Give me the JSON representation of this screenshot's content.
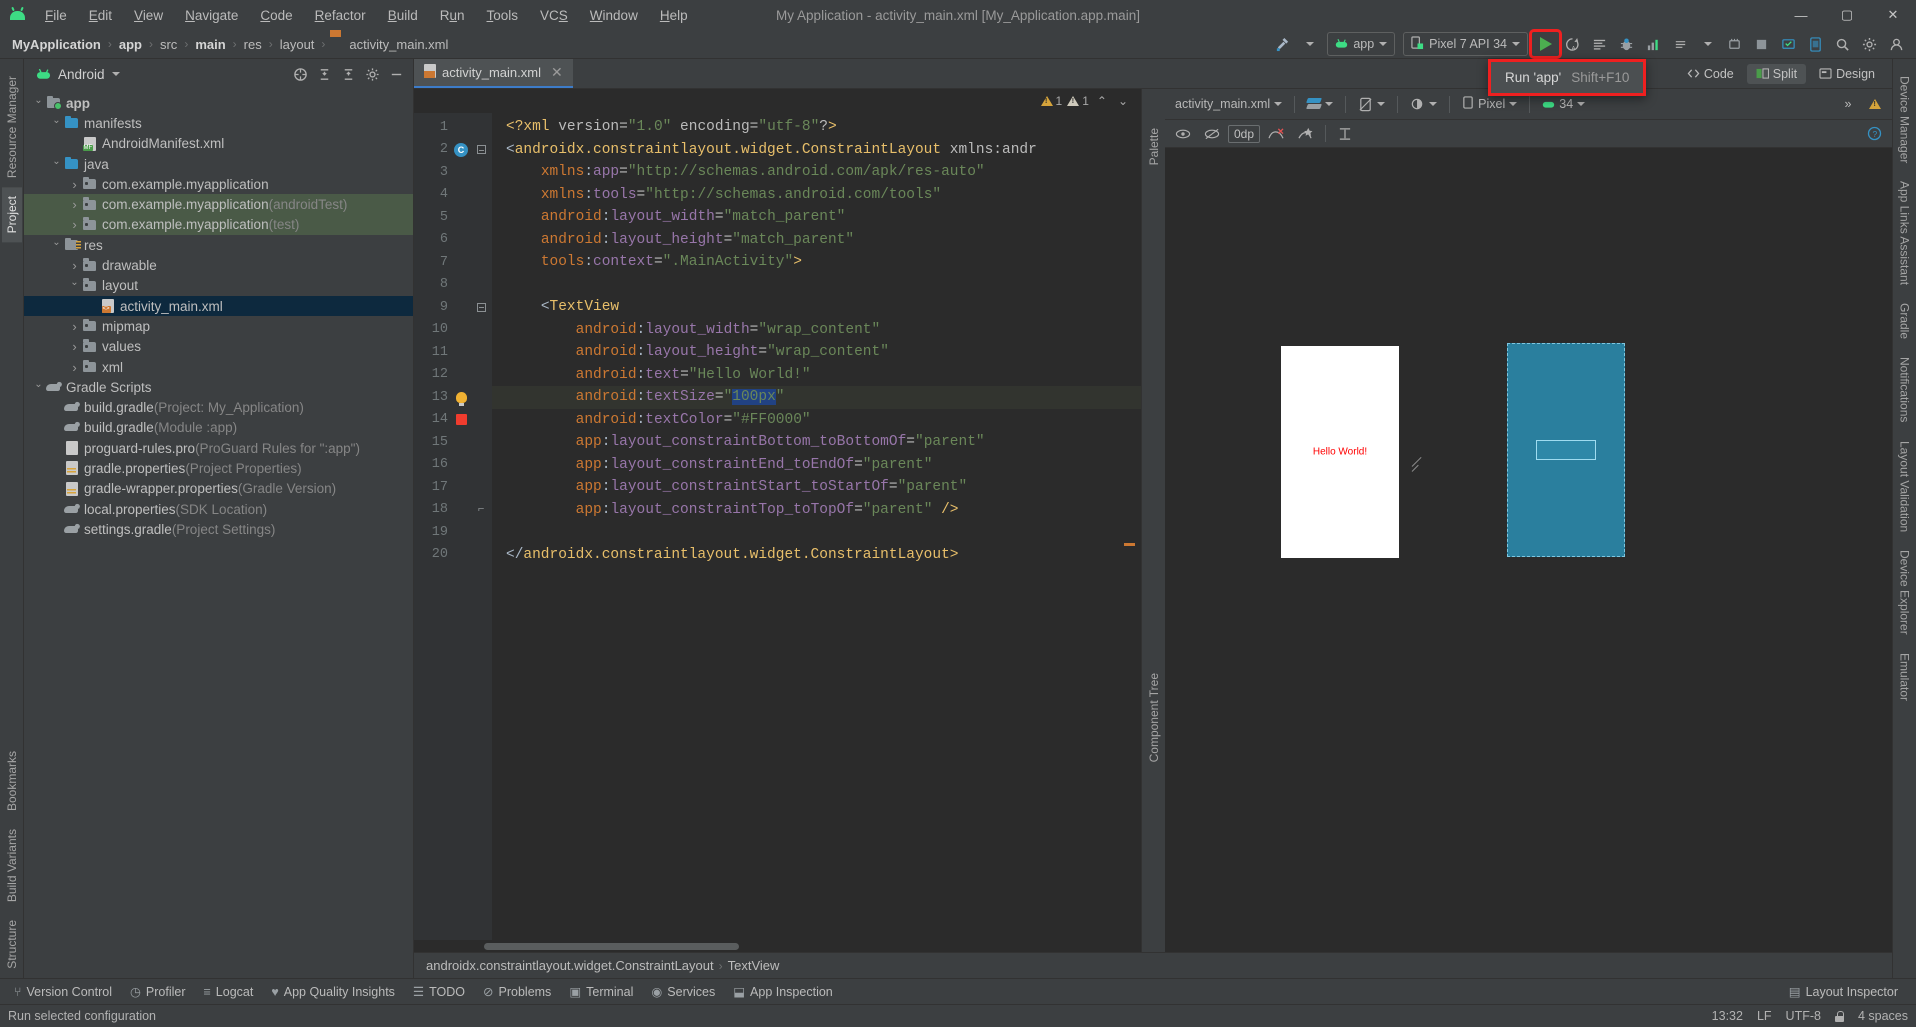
{
  "window": {
    "title": "My Application - activity_main.xml [My_Application.app.main]",
    "minimize": "—",
    "maximize": "▢",
    "close": "✕"
  },
  "menubar": {
    "items": [
      {
        "label": "File"
      },
      {
        "label": "Edit"
      },
      {
        "label": "View"
      },
      {
        "label": "Navigate"
      },
      {
        "label": "Code"
      },
      {
        "label": "Refactor"
      },
      {
        "label": "Build"
      },
      {
        "label": "Run"
      },
      {
        "label": "Tools"
      },
      {
        "label": "VCS"
      },
      {
        "label": "Window"
      },
      {
        "label": "Help"
      }
    ]
  },
  "breadcrumb": {
    "items": [
      "MyApplication",
      "app",
      "src",
      "main",
      "res",
      "layout",
      "activity_main.xml"
    ],
    "separator": "›"
  },
  "toolbar": {
    "build_variant_label": "",
    "module_selector": "app",
    "device_selector": "Pixel 7 API 34",
    "run_tooltip": "Run 'app'",
    "run_tooltip_shortcut": "Shift+F10"
  },
  "project_panel": {
    "title": "Android",
    "tree": [
      {
        "depth": 0,
        "arrow": "open",
        "icon": "folder-module",
        "label": "app",
        "suffix": "",
        "bold": true,
        "state": "none"
      },
      {
        "depth": 1,
        "arrow": "open",
        "icon": "folder-blue",
        "label": "manifests",
        "suffix": "",
        "bold": false,
        "state": "none"
      },
      {
        "depth": 2,
        "arrow": "none",
        "icon": "file-manifest",
        "label": "AndroidManifest.xml",
        "suffix": "",
        "bold": false,
        "state": "none"
      },
      {
        "depth": 1,
        "arrow": "open",
        "icon": "folder-blue",
        "label": "java",
        "suffix": "",
        "bold": false,
        "state": "none"
      },
      {
        "depth": 2,
        "arrow": "closed",
        "icon": "folder-pkg",
        "label": "com.example.myapplication",
        "suffix": "",
        "bold": false,
        "state": "none"
      },
      {
        "depth": 2,
        "arrow": "closed",
        "icon": "folder-pkg",
        "label": "com.example.myapplication",
        "suffix": "(androidTest)",
        "bold": false,
        "state": "green"
      },
      {
        "depth": 2,
        "arrow": "closed",
        "icon": "folder-pkg",
        "label": "com.example.myapplication",
        "suffix": "(test)",
        "bold": false,
        "state": "green"
      },
      {
        "depth": 1,
        "arrow": "open",
        "icon": "folder-res",
        "label": "res",
        "suffix": "",
        "bold": false,
        "state": "none"
      },
      {
        "depth": 2,
        "arrow": "closed",
        "icon": "folder-pkg",
        "label": "drawable",
        "suffix": "",
        "bold": false,
        "state": "none"
      },
      {
        "depth": 2,
        "arrow": "open",
        "icon": "folder-pkg",
        "label": "layout",
        "suffix": "",
        "bold": false,
        "state": "none"
      },
      {
        "depth": 3,
        "arrow": "none",
        "icon": "file-xml",
        "label": "activity_main.xml",
        "suffix": "",
        "bold": false,
        "state": "selected"
      },
      {
        "depth": 2,
        "arrow": "closed",
        "icon": "folder-pkg",
        "label": "mipmap",
        "suffix": "",
        "bold": false,
        "state": "none"
      },
      {
        "depth": 2,
        "arrow": "closed",
        "icon": "folder-pkg",
        "label": "values",
        "suffix": "",
        "bold": false,
        "state": "none"
      },
      {
        "depth": 2,
        "arrow": "closed",
        "icon": "folder-pkg",
        "label": "xml",
        "suffix": "",
        "bold": false,
        "state": "none"
      },
      {
        "depth": 0,
        "arrow": "open",
        "icon": "gradle",
        "label": "Gradle Scripts",
        "suffix": "",
        "bold": false,
        "state": "none"
      },
      {
        "depth": 1,
        "arrow": "none",
        "icon": "gradle",
        "label": "build.gradle",
        "suffix": "(Project: My_Application)",
        "bold": false,
        "state": "none"
      },
      {
        "depth": 1,
        "arrow": "none",
        "icon": "gradle",
        "label": "build.gradle",
        "suffix": "(Module :app)",
        "bold": false,
        "state": "none"
      },
      {
        "depth": 1,
        "arrow": "none",
        "icon": "file-plain",
        "label": "proguard-rules.pro",
        "suffix": "(ProGuard Rules for \":app\")",
        "bold": false,
        "state": "none"
      },
      {
        "depth": 1,
        "arrow": "none",
        "icon": "file-props",
        "label": "gradle.properties",
        "suffix": "(Project Properties)",
        "bold": false,
        "state": "none"
      },
      {
        "depth": 1,
        "arrow": "none",
        "icon": "file-props",
        "label": "gradle-wrapper.properties",
        "suffix": "(Gradle Version)",
        "bold": false,
        "state": "none"
      },
      {
        "depth": 1,
        "arrow": "none",
        "icon": "gradle",
        "label": "local.properties",
        "suffix": "(SDK Location)",
        "bold": false,
        "state": "none"
      },
      {
        "depth": 1,
        "arrow": "none",
        "icon": "gradle",
        "label": "settings.gradle",
        "suffix": "(Project Settings)",
        "bold": false,
        "state": "none"
      }
    ]
  },
  "left_rail": {
    "tabs": [
      "Project",
      "Resource Manager"
    ],
    "bottom_tabs": [
      "Structure",
      "Build Variants",
      "Bookmarks"
    ]
  },
  "right_rail": {
    "tabs": [
      "Device Manager",
      "App Links Assistant",
      "Gradle",
      "Notifications",
      "Layout Validation",
      "Device Explorer",
      "Emulator"
    ]
  },
  "editor": {
    "tab_label": "activity_main.xml",
    "tab_close": "✕",
    "view_modes": [
      {
        "label": "Code",
        "active": false
      },
      {
        "label": "Split",
        "active": true
      },
      {
        "label": "Design",
        "active": false
      }
    ],
    "warnings": {
      "error_count": "1",
      "warning_count": "1"
    },
    "bottom_breadcrumb": [
      "androidx.constraintlayout.widget.ConstraintLayout",
      "TextView"
    ],
    "code_lines": [
      {
        "n": 1,
        "marker": "none",
        "fold": "none",
        "highlight": false,
        "text": "<?xml version=\"1.0\" encoding=\"utf-8\"?>"
      },
      {
        "n": 2,
        "marker": "class",
        "fold": "minus",
        "highlight": false,
        "text": "<androidx.constraintlayout.widget.ConstraintLayout xmlns:andr"
      },
      {
        "n": 3,
        "marker": "none",
        "fold": "none",
        "highlight": false,
        "text": "    xmlns:app=\"http://schemas.android.com/apk/res-auto\""
      },
      {
        "n": 4,
        "marker": "none",
        "fold": "none",
        "highlight": false,
        "text": "    xmlns:tools=\"http://schemas.android.com/tools\""
      },
      {
        "n": 5,
        "marker": "none",
        "fold": "none",
        "highlight": false,
        "text": "    android:layout_width=\"match_parent\""
      },
      {
        "n": 6,
        "marker": "none",
        "fold": "none",
        "highlight": false,
        "text": "    android:layout_height=\"match_parent\""
      },
      {
        "n": 7,
        "marker": "none",
        "fold": "none",
        "highlight": false,
        "text": "    tools:context=\".MainActivity\">"
      },
      {
        "n": 8,
        "marker": "none",
        "fold": "none",
        "highlight": false,
        "text": ""
      },
      {
        "n": 9,
        "marker": "none",
        "fold": "minus",
        "highlight": false,
        "text": "    <TextView"
      },
      {
        "n": 10,
        "marker": "none",
        "fold": "none",
        "highlight": false,
        "text": "        android:layout_width=\"wrap_content\""
      },
      {
        "n": 11,
        "marker": "none",
        "fold": "none",
        "highlight": false,
        "text": "        android:layout_height=\"wrap_content\""
      },
      {
        "n": 12,
        "marker": "none",
        "fold": "none",
        "highlight": false,
        "text": "        android:text=\"Hello World!\""
      },
      {
        "n": 13,
        "marker": "bulb",
        "fold": "none",
        "highlight": true,
        "text": "        android:textSize=\"100px\""
      },
      {
        "n": 14,
        "marker": "bp",
        "fold": "none",
        "highlight": false,
        "text": "        android:textColor=\"#FF0000\""
      },
      {
        "n": 15,
        "marker": "none",
        "fold": "none",
        "highlight": false,
        "text": "        app:layout_constraintBottom_toBottomOf=\"parent\""
      },
      {
        "n": 16,
        "marker": "none",
        "fold": "none",
        "highlight": false,
        "text": "        app:layout_constraintEnd_toEndOf=\"parent\""
      },
      {
        "n": 17,
        "marker": "none",
        "fold": "none",
        "highlight": false,
        "text": "        app:layout_constraintStart_toStartOf=\"parent\""
      },
      {
        "n": 18,
        "marker": "none",
        "fold": "end",
        "highlight": false,
        "text": "        app:layout_constraintTop_toTopOf=\"parent\" />"
      },
      {
        "n": 19,
        "marker": "none",
        "fold": "none",
        "highlight": false,
        "text": ""
      },
      {
        "n": 20,
        "marker": "none",
        "fold": "none",
        "highlight": false,
        "text": "</androidx.constraintlayout.widget.ConstraintLayout>"
      }
    ],
    "selected_value": "100px",
    "text_color_value": "#FF0000"
  },
  "preview": {
    "file_selector": "activity_main.xml",
    "device_selector": "Pixel",
    "api_selector": "34",
    "dp_value": "0dp",
    "palette_label": "Palette",
    "component_tree_label": "Component Tree",
    "rendered_text": "Hello World!",
    "rendered_text_color": "#FF0000"
  },
  "bottom_toolwindows": [
    {
      "label": "Version Control",
      "icon": "branch-icon"
    },
    {
      "label": "Profiler",
      "icon": "profiler-icon"
    },
    {
      "label": "Logcat",
      "icon": "logcat-icon"
    },
    {
      "label": "App Quality Insights",
      "icon": "insights-icon"
    },
    {
      "label": "TODO",
      "icon": "todo-icon"
    },
    {
      "label": "Problems",
      "icon": "problems-icon"
    },
    {
      "label": "Terminal",
      "icon": "terminal-icon"
    },
    {
      "label": "Services",
      "icon": "services-icon"
    },
    {
      "label": "App Inspection",
      "icon": "inspection-icon"
    }
  ],
  "bottom_toolwindows_right": [
    {
      "label": "Layout Inspector",
      "icon": "layout-inspector-icon"
    }
  ],
  "statusbar": {
    "message": "Run selected configuration",
    "time": "13:32",
    "line_separator": "LF",
    "encoding": "UTF-8",
    "indent": "4 spaces"
  },
  "colors": {
    "accent_blue": "#3592c4",
    "run_green": "#4caf50",
    "highlight_red": "#ef2020",
    "text_red": "#FF0000",
    "selection_blue": "#0d293e"
  }
}
